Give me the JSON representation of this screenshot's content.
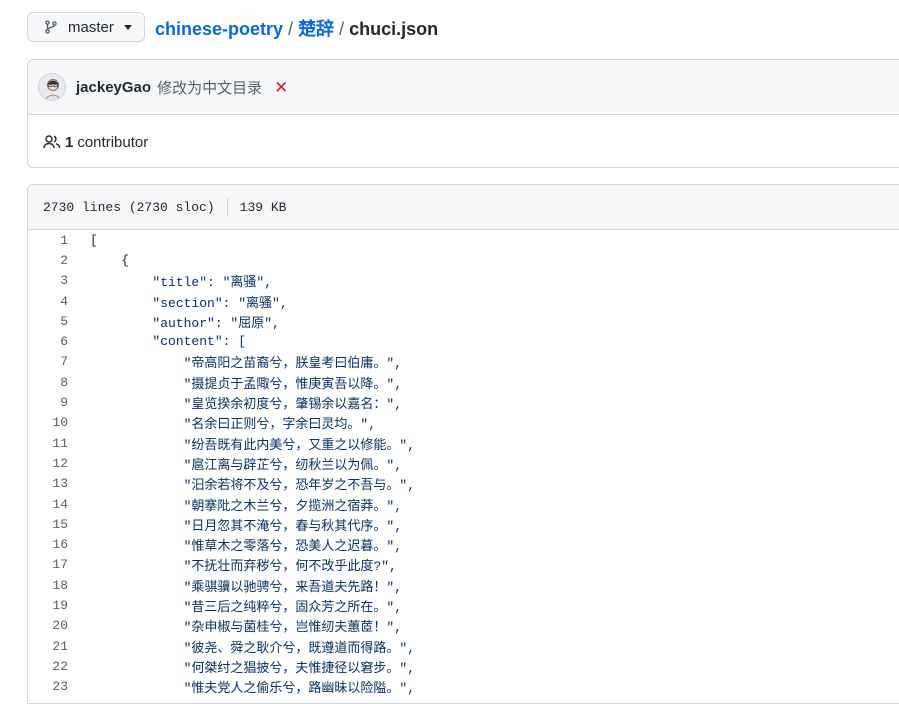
{
  "branch": {
    "label": "master"
  },
  "breadcrumb": {
    "repo": "chinese-poetry",
    "folder": "楚辞",
    "file": "chuci.json",
    "sep": "/"
  },
  "commit": {
    "author": "jackeyGao",
    "message": "修改为中文目录",
    "status": "✕"
  },
  "contributors": {
    "count": "1",
    "label": "contributor"
  },
  "file": {
    "lines": "2730 lines (2730 sloc)",
    "size": "139 KB"
  },
  "code_lines": [
    {
      "n": "1",
      "t": "["
    },
    {
      "n": "2",
      "t": "    {"
    },
    {
      "n": "3",
      "t": "        \"title\": \"离骚\","
    },
    {
      "n": "4",
      "t": "        \"section\": \"离骚\","
    },
    {
      "n": "5",
      "t": "        \"author\": \"屈原\","
    },
    {
      "n": "6",
      "t": "        \"content\": ["
    },
    {
      "n": "7",
      "t": "            \"帝高阳之苗裔兮，朕皇考曰伯庸。\","
    },
    {
      "n": "8",
      "t": "            \"摄提贞于孟陬兮，惟庚寅吾以降。\","
    },
    {
      "n": "9",
      "t": "            \"皇览揆余初度兮，肇锡余以嘉名：\","
    },
    {
      "n": "10",
      "t": "            \"名余曰正则兮，字余曰灵均。\","
    },
    {
      "n": "11",
      "t": "            \"纷吾既有此内美兮，又重之以修能。\","
    },
    {
      "n": "12",
      "t": "            \"扈江离与辟芷兮，纫秋兰以为佩。\","
    },
    {
      "n": "13",
      "t": "            \"汨余若将不及兮，恐年岁之不吾与。\","
    },
    {
      "n": "14",
      "t": "            \"朝搴阰之木兰兮，夕揽洲之宿莽。\","
    },
    {
      "n": "15",
      "t": "            \"日月忽其不淹兮，春与秋其代序。\","
    },
    {
      "n": "16",
      "t": "            \"惟草木之零落兮，恐美人之迟暮。\","
    },
    {
      "n": "17",
      "t": "            \"不抚壮而弃秽兮，何不改乎此度?\","
    },
    {
      "n": "18",
      "t": "            \"乘骐骥以驰骋兮，来吾道夫先路！\","
    },
    {
      "n": "19",
      "t": "            \"昔三后之纯粹兮，固众芳之所在。\","
    },
    {
      "n": "20",
      "t": "            \"杂申椒与菌桂兮，岂惟纫夫蕙茝！\","
    },
    {
      "n": "21",
      "t": "            \"彼尧、舜之耿介兮，既遵道而得路。\","
    },
    {
      "n": "22",
      "t": "            \"何桀纣之猖披兮，夫惟捷径以窘步。\","
    },
    {
      "n": "23",
      "t": "            \"惟夫党人之偷乐兮，路幽昧以险隘。\","
    }
  ],
  "colors": {
    "link": "#0969da",
    "danger": "#cf222e",
    "string": "#0a3069"
  }
}
